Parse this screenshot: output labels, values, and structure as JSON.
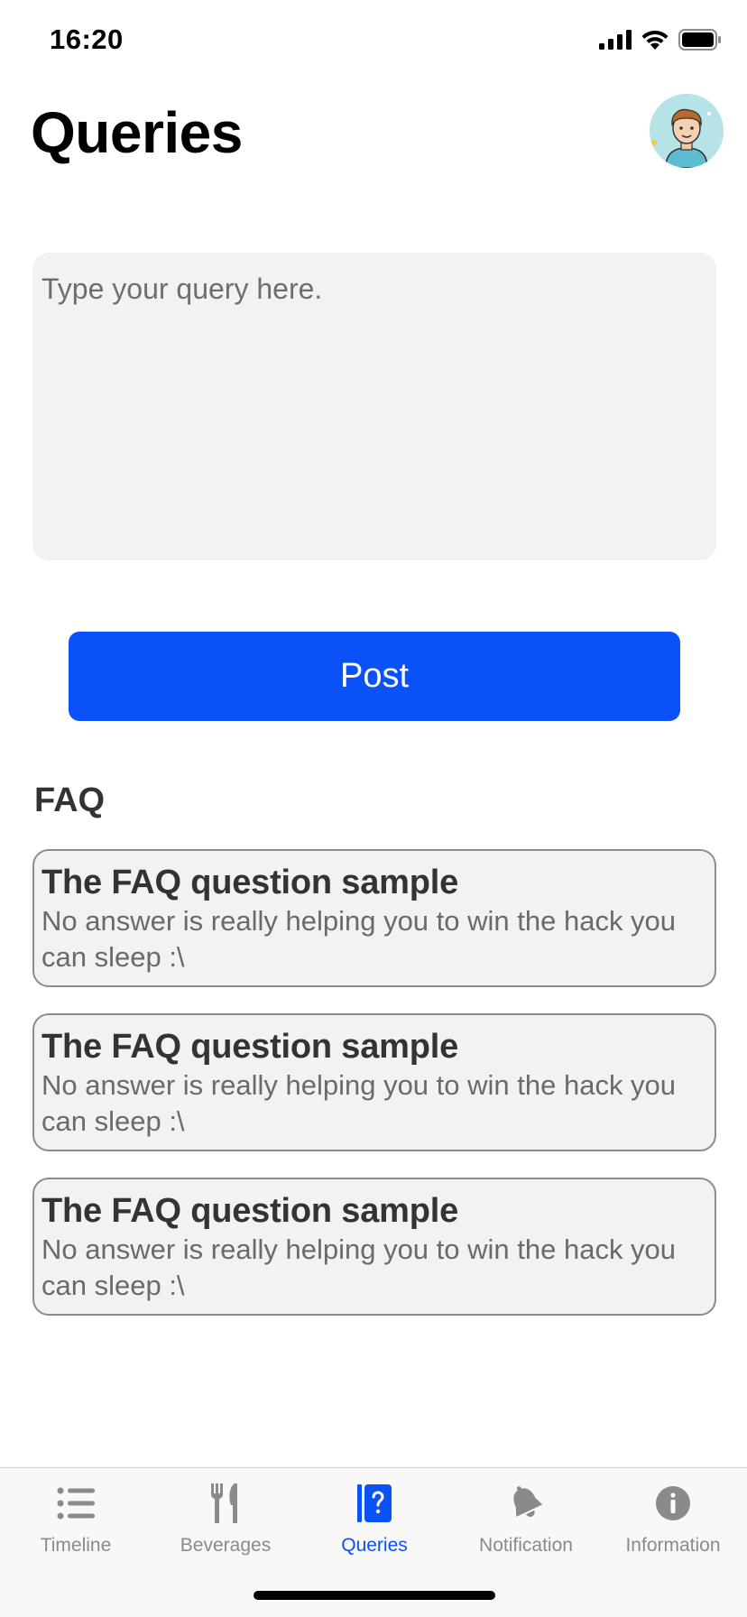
{
  "status_bar": {
    "time": "16:20"
  },
  "header": {
    "title": "Queries"
  },
  "query_input": {
    "placeholder": "Type your query here.",
    "value": ""
  },
  "post_button": {
    "label": "Post"
  },
  "faq": {
    "title": "FAQ",
    "items": [
      {
        "question": "The FAQ question sample",
        "answer": "No answer is really helping you to win the hack you can sleep :\\"
      },
      {
        "question": "The FAQ question sample",
        "answer": "No answer is really helping you to win the hack you can sleep :\\"
      },
      {
        "question": "The FAQ question sample",
        "answer": "No answer is really helping you to win the hack you can sleep :\\"
      }
    ]
  },
  "tab_bar": {
    "tabs": [
      {
        "label": "Timeline",
        "icon": "list-icon",
        "active": false
      },
      {
        "label": "Beverages",
        "icon": "fork-knife-icon",
        "active": false
      },
      {
        "label": "Queries",
        "icon": "question-book-icon",
        "active": true
      },
      {
        "label": "Notification",
        "icon": "bell-icon",
        "active": false
      },
      {
        "label": "Information",
        "icon": "info-icon",
        "active": false
      }
    ]
  },
  "colors": {
    "accent": "#0a52f7",
    "inactive_tab": "#8a8a8a",
    "card_bg": "#f2f2f2"
  }
}
